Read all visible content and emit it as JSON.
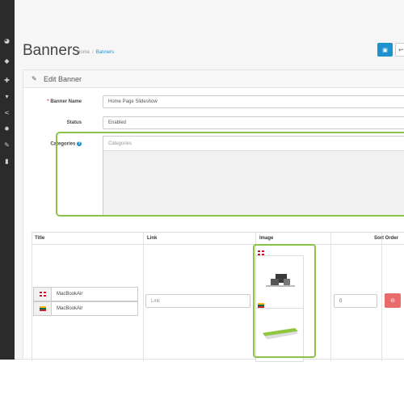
{
  "sidebar": {
    "icons": [
      "dashboard-icon",
      "tags-icon",
      "puzzle-icon",
      "cart-icon",
      "share-icon",
      "gear-icon",
      "wrench-icon",
      "chart-icon"
    ]
  },
  "header": {
    "title": "Banners",
    "breadcrumb": [
      "Home",
      "Banners"
    ],
    "save_icon": "save-icon",
    "back_icon": "back-icon",
    "accent_color": "#1e91cf"
  },
  "panel": {
    "title": "Edit Banner"
  },
  "form": {
    "name_label": "Banner Name",
    "name_value": "Home Page Slideshow",
    "status_label": "Status",
    "status_value": "Enabled",
    "categories_label": "Categories",
    "categories_placeholder": "Categories"
  },
  "table": {
    "headers": [
      "Title",
      "Link",
      "Image",
      "Sort Order"
    ],
    "row": {
      "titles": [
        "MacBookAir",
        "MacBookAir"
      ],
      "link_placeholder": "Link",
      "sort_order": "0"
    }
  },
  "highlight_color": "#8bc34a",
  "danger_color": "#e96b6b"
}
